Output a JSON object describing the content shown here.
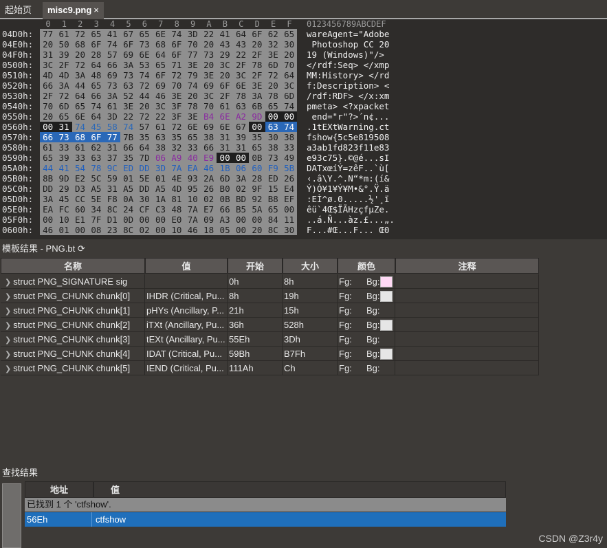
{
  "tabs": [
    {
      "label": "起始页",
      "active": false
    },
    {
      "label": "misc9.png",
      "active": true,
      "close": "×"
    }
  ],
  "hex": {
    "col_headers": [
      "0",
      "1",
      "2",
      "3",
      "4",
      "5",
      "6",
      "7",
      "8",
      "9",
      "A",
      "B",
      "C",
      "D",
      "E",
      "F"
    ],
    "ascii_header": "0123456789ABCDEF",
    "rows": [
      {
        "addr": "04D0h:",
        "bytes": [
          "77",
          "61",
          "72",
          "65",
          "41",
          "67",
          "65",
          "6E",
          "74",
          "3D",
          "22",
          "41",
          "64",
          "6F",
          "62",
          "65"
        ],
        "ascii": "wareAgent=\"Adobe"
      },
      {
        "addr": "04E0h:",
        "bytes": [
          "20",
          "50",
          "68",
          "6F",
          "74",
          "6F",
          "73",
          "68",
          "6F",
          "70",
          "20",
          "43",
          "43",
          "20",
          "32",
          "30"
        ],
        "ascii": " Photoshop CC 20"
      },
      {
        "addr": "04F0h:",
        "bytes": [
          "31",
          "39",
          "20",
          "28",
          "57",
          "69",
          "6E",
          "64",
          "6F",
          "77",
          "73",
          "29",
          "22",
          "2F",
          "3E",
          "20"
        ],
        "ascii": "19 (Windows)\"/> "
      },
      {
        "addr": "0500h:",
        "bytes": [
          "3C",
          "2F",
          "72",
          "64",
          "66",
          "3A",
          "53",
          "65",
          "71",
          "3E",
          "20",
          "3C",
          "2F",
          "78",
          "6D",
          "70"
        ],
        "ascii": "</rdf:Seq> </xmp"
      },
      {
        "addr": "0510h:",
        "bytes": [
          "4D",
          "4D",
          "3A",
          "48",
          "69",
          "73",
          "74",
          "6F",
          "72",
          "79",
          "3E",
          "20",
          "3C",
          "2F",
          "72",
          "64"
        ],
        "ascii": "MM:History> </rd"
      },
      {
        "addr": "0520h:",
        "bytes": [
          "66",
          "3A",
          "44",
          "65",
          "73",
          "63",
          "72",
          "69",
          "70",
          "74",
          "69",
          "6F",
          "6E",
          "3E",
          "20",
          "3C"
        ],
        "ascii": "f:Description> <"
      },
      {
        "addr": "0530h:",
        "bytes": [
          "2F",
          "72",
          "64",
          "66",
          "3A",
          "52",
          "44",
          "46",
          "3E",
          "20",
          "3C",
          "2F",
          "78",
          "3A",
          "78",
          "6D"
        ],
        "ascii": "/rdf:RDF> </x:xm"
      },
      {
        "addr": "0540h:",
        "bytes": [
          "70",
          "6D",
          "65",
          "74",
          "61",
          "3E",
          "20",
          "3C",
          "3F",
          "78",
          "70",
          "61",
          "63",
          "6B",
          "65",
          "74"
        ],
        "ascii": "pmeta> <?xpacket"
      },
      {
        "addr": "0550h:",
        "bytes": [
          "20",
          "65",
          "6E",
          "64",
          "3D",
          "22",
          "72",
          "22",
          "3F",
          "3E",
          "B4",
          "6E",
          "A2",
          "9D",
          "00",
          "00"
        ],
        "ascii": " end=\"r\"?>´n¢..."
      },
      {
        "addr": "0560h:",
        "bytes": [
          "00",
          "31",
          "74",
          "45",
          "58",
          "74",
          "57",
          "61",
          "72",
          "6E",
          "69",
          "6E",
          "67",
          "00",
          "63",
          "74"
        ],
        "ascii": ".1tEXtWarning.ct"
      },
      {
        "addr": "0570h:",
        "bytes": [
          "66",
          "73",
          "68",
          "6F",
          "77",
          "7B",
          "35",
          "63",
          "35",
          "65",
          "38",
          "31",
          "39",
          "35",
          "30",
          "38"
        ],
        "ascii": "fshow{5c5e819508"
      },
      {
        "addr": "0580h:",
        "bytes": [
          "61",
          "33",
          "61",
          "62",
          "31",
          "66",
          "64",
          "38",
          "32",
          "33",
          "66",
          "31",
          "31",
          "65",
          "38",
          "33"
        ],
        "ascii": "a3ab1fd823f11e83"
      },
      {
        "addr": "0590h:",
        "bytes": [
          "65",
          "39",
          "33",
          "63",
          "37",
          "35",
          "7D",
          "06",
          "A9",
          "40",
          "E9",
          "00",
          "00",
          "0B",
          "73",
          "49"
        ],
        "ascii": "e93c75}.©@é...sI"
      },
      {
        "addr": "05A0h:",
        "bytes": [
          "44",
          "41",
          "54",
          "78",
          "9C",
          "ED",
          "DD",
          "3D",
          "7A",
          "EA",
          "46",
          "1B",
          "06",
          "60",
          "F9",
          "5B"
        ],
        "ascii": "DATxœíÝ=zêF..`ù["
      },
      {
        "addr": "05B0h:",
        "bytes": [
          "8B",
          "9D",
          "E2",
          "5C",
          "59",
          "01",
          "5E",
          "01",
          "4E",
          "93",
          "2A",
          "6D",
          "3A",
          "28",
          "ED",
          "26"
        ],
        "ascii": "‹.â\\Y.^.N“*m:(í&"
      },
      {
        "addr": "05C0h:",
        "bytes": [
          "DD",
          "29",
          "D3",
          "A5",
          "31",
          "A5",
          "DD",
          "A5",
          "4D",
          "95",
          "26",
          "B0",
          "02",
          "9F",
          "15",
          "E4"
        ],
        "ascii": "Ý)Ó¥1¥Ý¥M•&°.Ÿ.ä"
      },
      {
        "addr": "05D0h:",
        "bytes": [
          "3A",
          "45",
          "CC",
          "5E",
          "F8",
          "0A",
          "30",
          "1A",
          "81",
          "10",
          "02",
          "0B",
          "BD",
          "92",
          "B8",
          "EF"
        ],
        "ascii": ":EÌ^ø.0.....½'¸ï"
      },
      {
        "addr": "05E0h:",
        "bytes": [
          "EA",
          "FC",
          "60",
          "34",
          "8C",
          "24",
          "CF",
          "C3",
          "48",
          "7A",
          "E7",
          "66",
          "B5",
          "5A",
          "65",
          "00"
        ],
        "ascii": "êü`4Œ$ÏÃHzçfµZe."
      },
      {
        "addr": "05F0h:",
        "bytes": [
          "00",
          "10",
          "E1",
          "7F",
          "D1",
          "0D",
          "00",
          "00",
          "E0",
          "7A",
          "09",
          "A3",
          "00",
          "00",
          "84",
          "11"
        ],
        "ascii": "..á.Ñ...àz.£...„."
      },
      {
        "addr": "0600h:",
        "bytes": [
          "46",
          "01",
          "00",
          "08",
          "23",
          "8C",
          "02",
          "00",
          "10",
          "46",
          "18",
          "05",
          "00",
          "20",
          "8C",
          "30"
        ],
        "ascii": "F...#Œ...F... Œ0"
      }
    ]
  },
  "template": {
    "title": "模板结果 - PNG.bt",
    "refresh_icon": "refresh-icon",
    "columns": [
      "名称",
      "值",
      "开始",
      "大小",
      "颜色",
      "注释"
    ],
    "rows": [
      {
        "name": "struct PNG_SIGNATURE sig",
        "value": "",
        "start": "0h",
        "size": "8h",
        "fg": "Fg:",
        "bg": "Bg:",
        "bgcolor": "#ffd9f5"
      },
      {
        "name": "struct PNG_CHUNK chunk[0]",
        "value": "IHDR  (Critical, Pu...",
        "start": "8h",
        "size": "19h",
        "fg": "Fg:",
        "bg": "Bg:",
        "bgcolor": "#e6e6e6"
      },
      {
        "name": "struct PNG_CHUNK chunk[1]",
        "value": "pHYs  (Ancillary, P...",
        "start": "21h",
        "size": "15h",
        "fg": "Fg:",
        "bg": "Bg:",
        "bgcolor": ""
      },
      {
        "name": "struct PNG_CHUNK chunk[2]",
        "value": "iTXt  (Ancillary, Pu...",
        "start": "36h",
        "size": "528h",
        "fg": "Fg:",
        "bg": "Bg:",
        "bgcolor": "#e6e6e6"
      },
      {
        "name": "struct PNG_CHUNK chunk[3]",
        "value": "tEXt  (Ancillary, Pu...",
        "start": "55Eh",
        "size": "3Dh",
        "fg": "Fg:",
        "bg": "Bg:",
        "bgcolor": ""
      },
      {
        "name": "struct PNG_CHUNK chunk[4]",
        "value": "IDAT  (Critical, Pu...",
        "start": "59Bh",
        "size": "B7Fh",
        "fg": "Fg:",
        "bg": "Bg:",
        "bgcolor": "#e6e6e6"
      },
      {
        "name": "struct PNG_CHUNK chunk[5]",
        "value": "IEND  (Critical, Pu...",
        "start": "111Ah",
        "size": "Ch",
        "fg": "Fg:",
        "bg": "Bg:",
        "bgcolor": ""
      }
    ]
  },
  "search": {
    "title": "查找结果",
    "columns": [
      "地址",
      "值"
    ],
    "found_text": "已找到 1 个 'ctfshow'.",
    "result": {
      "address": "56Eh",
      "value": "ctfshow"
    }
  },
  "watermark": "CSDN @Z3r4y"
}
